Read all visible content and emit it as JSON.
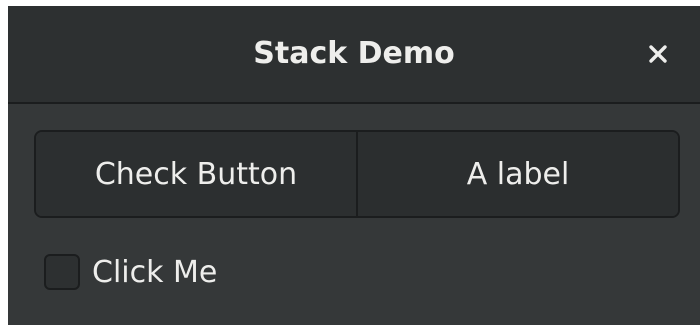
{
  "window": {
    "title": "Stack Demo",
    "close_icon": "close-icon"
  },
  "stack_switcher": {
    "tabs": [
      {
        "label": "Check Button",
        "selected": true
      },
      {
        "label": "A label",
        "selected": false
      }
    ]
  },
  "content": {
    "checkbox": {
      "label": "Click Me",
      "checked": false
    }
  },
  "colors": {
    "window_bg": "#353839",
    "titlebar_bg": "#2d3031",
    "text": "#eeeeec",
    "border": "#1b1d1e"
  }
}
